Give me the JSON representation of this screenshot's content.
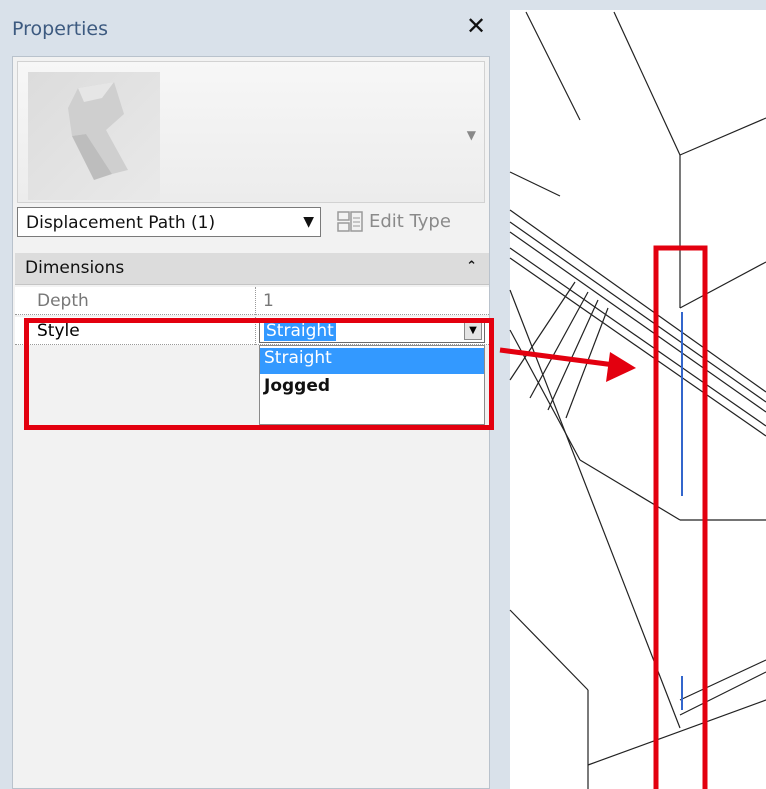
{
  "panel": {
    "title": "Properties",
    "close_glyph": "✕"
  },
  "type_selector": {
    "label": "Displacement Path (1)",
    "arrow": "▼"
  },
  "edit_type": {
    "label": "Edit Type",
    "icon": "edit-type-icon"
  },
  "category": {
    "label": "Dimensions",
    "collapse_glyph": "⌃"
  },
  "properties": [
    {
      "name": "Depth",
      "value": "1"
    },
    {
      "name": "Style",
      "value": "Straight"
    }
  ],
  "style_dropdown": {
    "selected": "Straight",
    "arrow": "▼",
    "options": [
      "Straight",
      "Jogged"
    ]
  },
  "annotation": {
    "highlight_color": "#e3000f"
  },
  "colors": {
    "selection": "#3399ff",
    "panel_bg": "#d9e1ea",
    "title_text": "#3d5a80",
    "blue_line": "#3366cc"
  }
}
